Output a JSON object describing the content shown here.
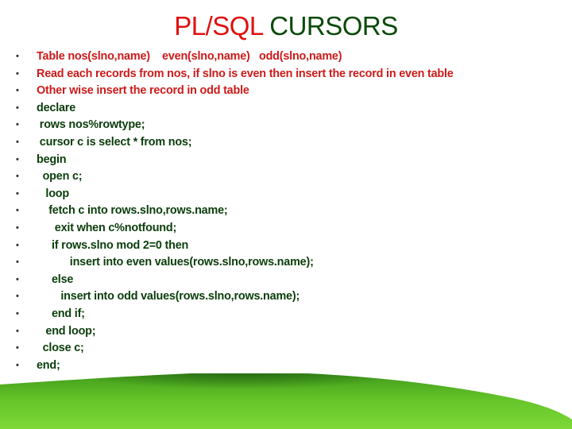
{
  "title": {
    "part1": "PL/SQL",
    "part2": "CURSORS"
  },
  "colors": {
    "title_red": "#e01010",
    "title_green": "#0a4a0a",
    "text_red": "#cc1a1a",
    "text_green": "#0b3d0b",
    "grass": "#6fcf2a"
  },
  "lines": [
    {
      "text": "Table nos(slno,name)    even(slno,name)   odd(slno,name)",
      "red": true
    },
    {
      "text": "Read each records from nos, if slno is even then insert the record in even table",
      "red": true
    },
    {
      "text": "Other wise insert the record in odd table",
      "red": true
    },
    {
      "text": "declare"
    },
    {
      "text": " rows nos%rowtype;"
    },
    {
      "text": " cursor c is select * from nos;"
    },
    {
      "text": "begin"
    },
    {
      "text": "  open c;"
    },
    {
      "text": "   loop"
    },
    {
      "text": "    fetch c into rows.slno,rows.name;"
    },
    {
      "text": "      exit when c%notfound;"
    },
    {
      "text": "     if rows.slno mod 2=0 then"
    },
    {
      "text": "           insert into even values(rows.slno,rows.name);"
    },
    {
      "text": "     else"
    },
    {
      "text": "        insert into odd values(rows.slno,rows.name);"
    },
    {
      "text": "     end if;"
    },
    {
      "text": "   end loop;"
    },
    {
      "text": "  close c;"
    },
    {
      "text": "end;"
    }
  ]
}
